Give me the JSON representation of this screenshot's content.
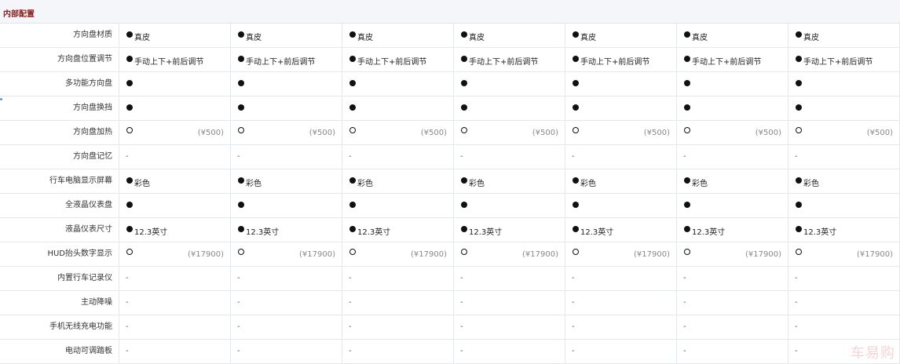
{
  "section": {
    "title": "内部配置"
  },
  "watermark": "车易购",
  "rows": [
    {
      "label": "方向盘材质",
      "cells": [
        {
          "mark": "filled",
          "text": "真皮"
        },
        {
          "mark": "filled",
          "text": "真皮"
        },
        {
          "mark": "filled",
          "text": "真皮"
        },
        {
          "mark": "filled",
          "text": "真皮"
        },
        {
          "mark": "filled",
          "text": "真皮"
        },
        {
          "mark": "filled",
          "text": "真皮"
        },
        {
          "mark": "filled",
          "text": "真皮"
        }
      ]
    },
    {
      "label": "方向盘位置调节",
      "cells": [
        {
          "mark": "filled",
          "text": "手动上下+前后调节"
        },
        {
          "mark": "filled",
          "text": "手动上下+前后调节"
        },
        {
          "mark": "filled",
          "text": "手动上下+前后调节"
        },
        {
          "mark": "filled",
          "text": "手动上下+前后调节"
        },
        {
          "mark": "filled",
          "text": "手动上下+前后调节"
        },
        {
          "mark": "filled",
          "text": "手动上下+前后调节"
        },
        {
          "mark": "filled",
          "text": "手动上下+前后调节"
        }
      ]
    },
    {
      "label": "多功能方向盘",
      "cells": [
        {
          "mark": "filled"
        },
        {
          "mark": "filled"
        },
        {
          "mark": "filled"
        },
        {
          "mark": "filled"
        },
        {
          "mark": "filled"
        },
        {
          "mark": "filled"
        },
        {
          "mark": "filled"
        }
      ]
    },
    {
      "label": "方向盘换挡",
      "cells": [
        {
          "mark": "filled"
        },
        {
          "mark": "filled"
        },
        {
          "mark": "filled"
        },
        {
          "mark": "filled"
        },
        {
          "mark": "filled"
        },
        {
          "mark": "filled"
        },
        {
          "mark": "filled"
        }
      ]
    },
    {
      "label": "方向盘加热",
      "cells": [
        {
          "mark": "empty",
          "price": "(¥500)"
        },
        {
          "mark": "empty",
          "price": "(¥500)"
        },
        {
          "mark": "empty",
          "price": "(¥500)"
        },
        {
          "mark": "empty",
          "price": "(¥500)"
        },
        {
          "mark": "empty",
          "price": "(¥500)"
        },
        {
          "mark": "empty",
          "price": "(¥500)"
        },
        {
          "mark": "empty",
          "price": "(¥500)"
        }
      ]
    },
    {
      "label": "方向盘记忆",
      "cells": [
        {
          "dash": "-"
        },
        {
          "dash": "-"
        },
        {
          "dash": "-"
        },
        {
          "dash": "-"
        },
        {
          "dash": "-"
        },
        {
          "dash": "-"
        },
        {
          "dash": "-"
        }
      ]
    },
    {
      "label": "行车电脑显示屏幕",
      "cells": [
        {
          "mark": "filled",
          "text": "彩色"
        },
        {
          "mark": "filled",
          "text": "彩色"
        },
        {
          "mark": "filled",
          "text": "彩色"
        },
        {
          "mark": "filled",
          "text": "彩色"
        },
        {
          "mark": "filled",
          "text": "彩色"
        },
        {
          "mark": "filled",
          "text": "彩色"
        },
        {
          "mark": "filled",
          "text": "彩色"
        }
      ]
    },
    {
      "label": "全液晶仪表盘",
      "cells": [
        {
          "mark": "filled"
        },
        {
          "mark": "filled"
        },
        {
          "mark": "filled"
        },
        {
          "mark": "filled"
        },
        {
          "mark": "filled"
        },
        {
          "mark": "filled"
        },
        {
          "mark": "filled"
        }
      ]
    },
    {
      "label": "液晶仪表尺寸",
      "cells": [
        {
          "mark": "filled",
          "text": "12.3英寸"
        },
        {
          "mark": "filled",
          "text": "12.3英寸"
        },
        {
          "mark": "filled",
          "text": "12.3英寸"
        },
        {
          "mark": "filled",
          "text": "12.3英寸"
        },
        {
          "mark": "filled",
          "text": "12.3英寸"
        },
        {
          "mark": "filled",
          "text": "12.3英寸"
        },
        {
          "mark": "filled",
          "text": "12.3英寸"
        }
      ]
    },
    {
      "label": "HUD抬头数字显示",
      "cells": [
        {
          "mark": "empty",
          "price": "(¥17900)"
        },
        {
          "mark": "empty",
          "price": "(¥17900)"
        },
        {
          "mark": "empty",
          "price": "(¥17900)"
        },
        {
          "mark": "empty",
          "price": "(¥17900)"
        },
        {
          "mark": "empty",
          "price": "(¥17900)"
        },
        {
          "mark": "empty",
          "price": "(¥17900)"
        },
        {
          "mark": "empty",
          "price": "(¥17900)"
        }
      ]
    },
    {
      "label": "内置行车记录仪",
      "cells": [
        {
          "dash": "-"
        },
        {
          "dash": "-"
        },
        {
          "dash": "-"
        },
        {
          "dash": "-"
        },
        {
          "dash": "-"
        },
        {
          "dash": "-"
        },
        {
          "dash": "-"
        }
      ]
    },
    {
      "label": "主动降噪",
      "cells": [
        {
          "dash": "-"
        },
        {
          "dash": "-"
        },
        {
          "dash": "-"
        },
        {
          "dash": "-"
        },
        {
          "dash": "-"
        },
        {
          "dash": "-"
        },
        {
          "dash": "-"
        }
      ]
    },
    {
      "label": "手机无线充电功能",
      "cells": [
        {
          "dash": "-"
        },
        {
          "dash": "-"
        },
        {
          "dash": "-"
        },
        {
          "dash": "-"
        },
        {
          "dash": "-"
        },
        {
          "dash": "-"
        },
        {
          "dash": "-"
        }
      ]
    },
    {
      "label": "电动可调踏板",
      "cells": [
        {
          "dash": "-"
        },
        {
          "dash": "-"
        },
        {
          "dash": "-"
        },
        {
          "dash": "-"
        },
        {
          "dash": "-"
        },
        {
          "dash": "-"
        },
        {
          "dash": "-"
        }
      ]
    }
  ]
}
